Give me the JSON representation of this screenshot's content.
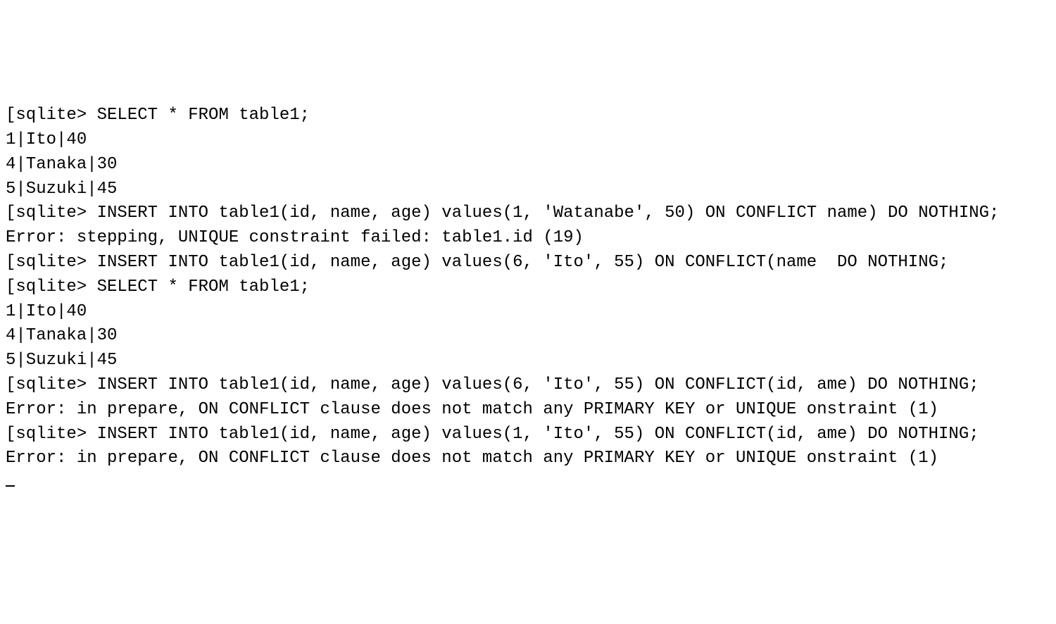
{
  "terminal": {
    "lines": [
      "[sqlite> SELECT * FROM table1;",
      "1|Ito|40",
      "4|Tanaka|30",
      "5|Suzuki|45",
      "[sqlite> INSERT INTO table1(id, name, age) values(1, 'Watanabe', 50) ON CONFLICT name) DO NOTHING;",
      "Error: stepping, UNIQUE constraint failed: table1.id (19)",
      "[sqlite> INSERT INTO table1(id, name, age) values(6, 'Ito', 55) ON CONFLICT(name  DO NOTHING;",
      "[sqlite> SELECT * FROM table1;",
      "1|Ito|40",
      "4|Tanaka|30",
      "5|Suzuki|45",
      "[sqlite> INSERT INTO table1(id, name, age) values(6, 'Ito', 55) ON CONFLICT(id, ame) DO NOTHING;",
      "Error: in prepare, ON CONFLICT clause does not match any PRIMARY KEY or UNIQUE onstraint (1)",
      "[sqlite> INSERT INTO table1(id, name, age) values(1, 'Ito', 55) ON CONFLICT(id, ame) DO NOTHING;",
      "Error: in prepare, ON CONFLICT clause does not match any PRIMARY KEY or UNIQUE onstraint (1)"
    ]
  }
}
